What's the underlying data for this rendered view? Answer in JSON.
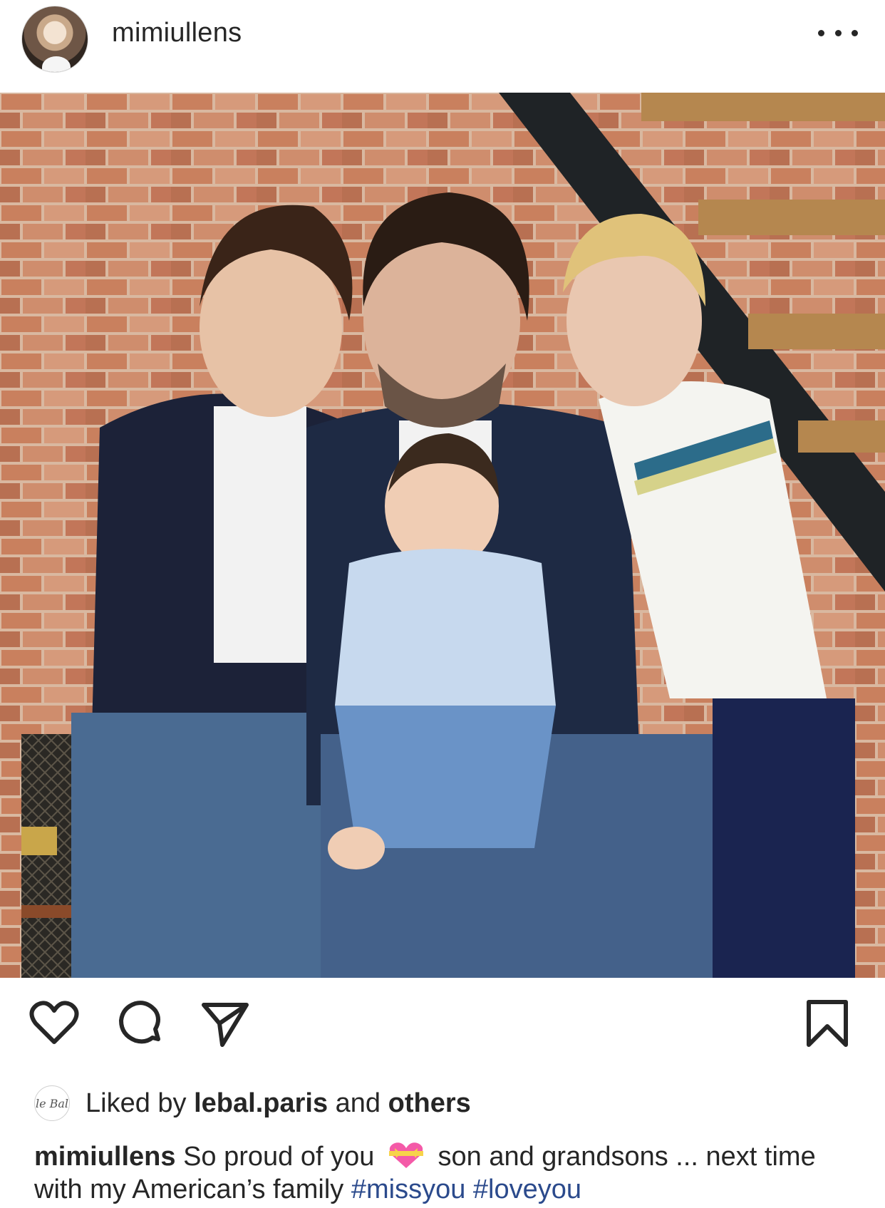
{
  "post": {
    "username": "mimiullens",
    "more_icon": "more-horizontal-icon",
    "photo_icon": "tagged-user-icon"
  },
  "actions": {
    "like_icon": "heart-icon",
    "comment_icon": "comment-icon",
    "share_icon": "paper-plane-icon",
    "save_icon": "bookmark-icon"
  },
  "likes": {
    "avatar_text": "le Bal",
    "prefix": "Liked by",
    "liker": "lebal.paris",
    "conjunction": "and",
    "suffix": "others"
  },
  "caption": {
    "username": "mimiullens",
    "text_before_emoji": "So proud of you",
    "emoji": "heart-with-ribbon-emoji",
    "text_after_emoji": "son and grandsons ... next time with my American’s family",
    "hashtags": [
      "#missyou",
      "#loveyou"
    ]
  },
  "colors": {
    "text": "#262626",
    "hashtag": "#2b4a8c",
    "background": "#ffffff"
  }
}
